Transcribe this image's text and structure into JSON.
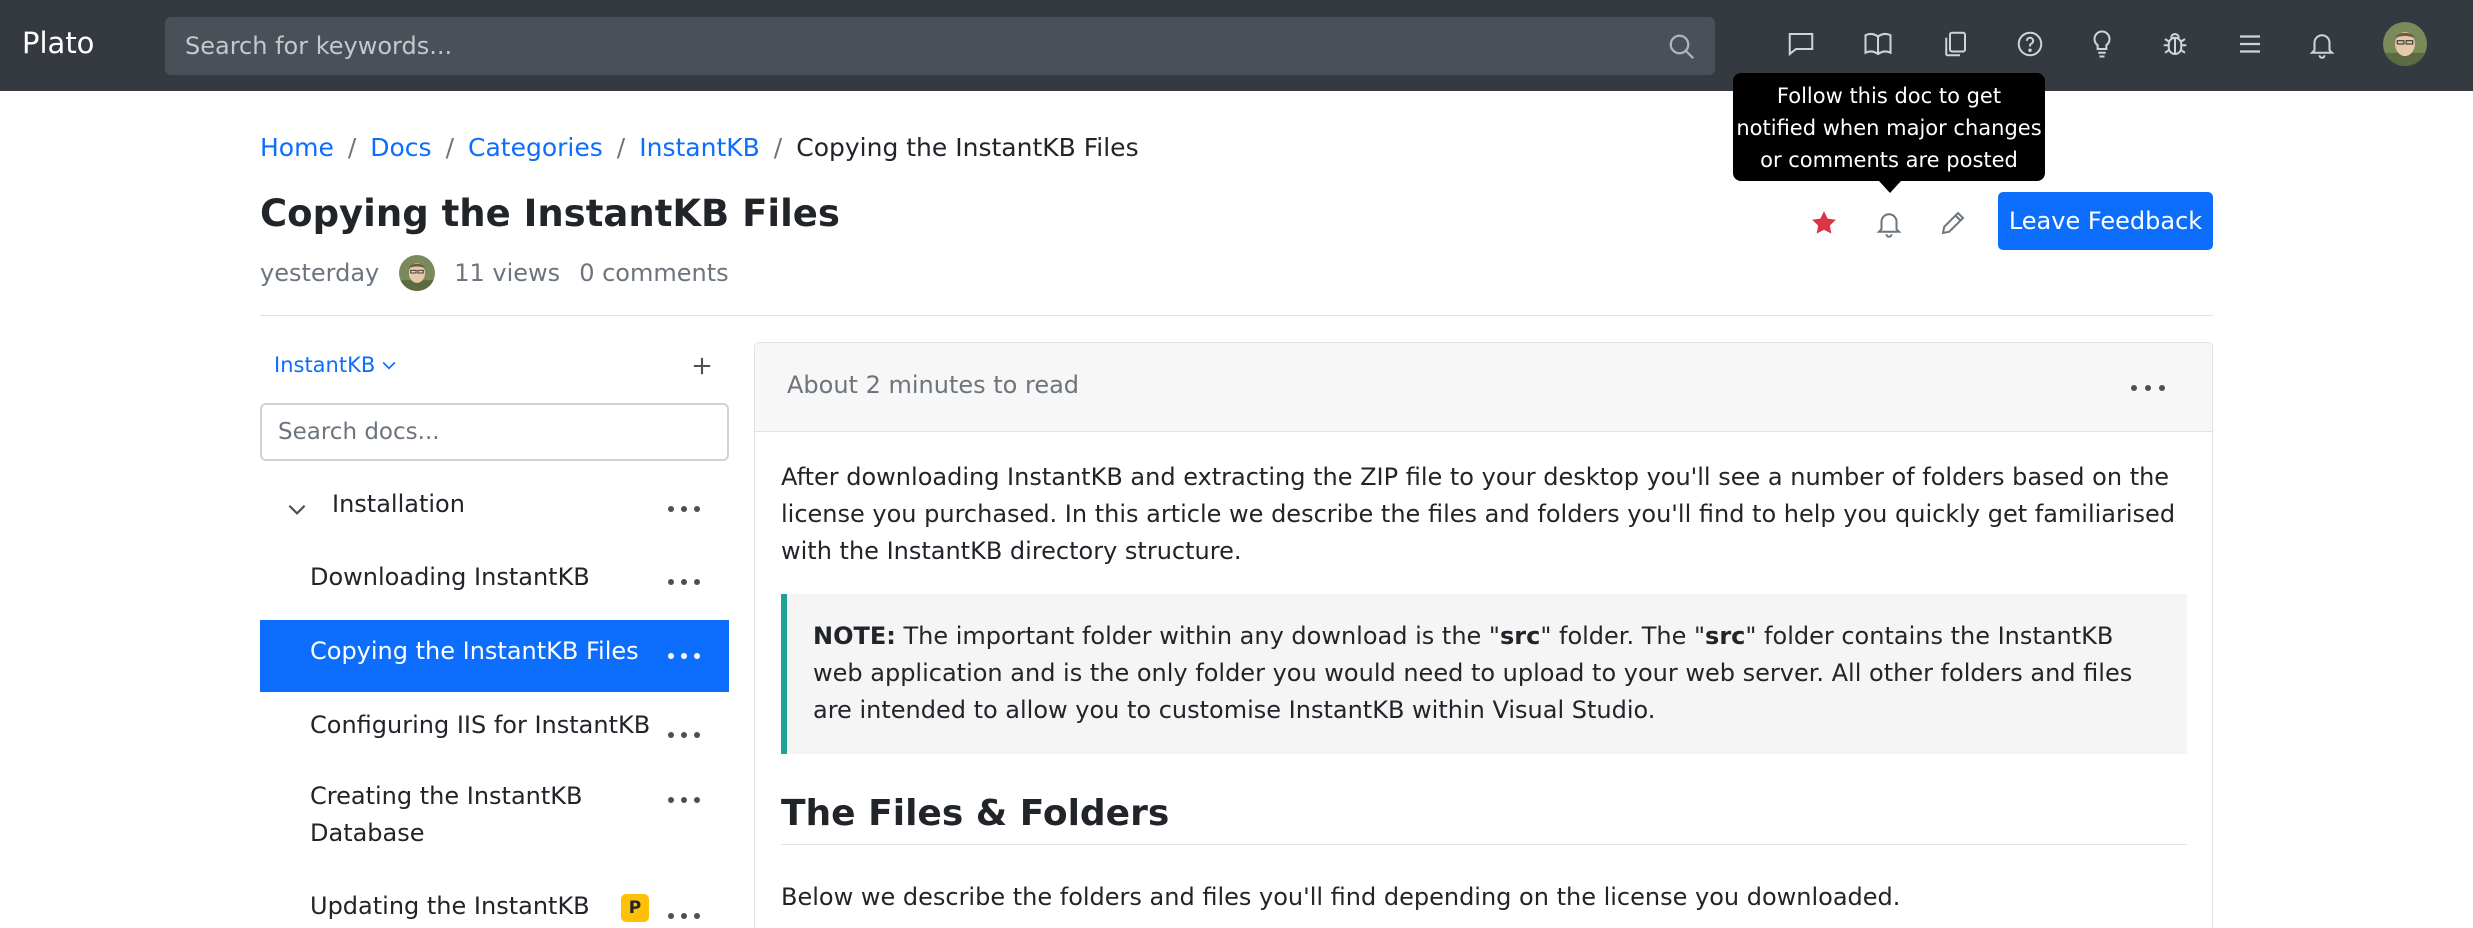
{
  "navbar": {
    "brand": "Plato",
    "search_placeholder": "Search for keywords...",
    "icons": [
      "chat-icon",
      "book-open-icon",
      "copy-docs-icon",
      "question-circle-icon",
      "lightbulb-icon",
      "bug-icon",
      "menu-list-icon",
      "bell-icon"
    ]
  },
  "tooltip": {
    "line1": "Follow this doc to get",
    "line2": "notified when major changes",
    "line3": "or comments are posted"
  },
  "breadcrumb": {
    "items": [
      "Home",
      "Docs",
      "Categories",
      "InstantKB"
    ],
    "current": "Copying the InstantKB Files"
  },
  "doc": {
    "title": "Copying the InstantKB Files",
    "date": "yesterday",
    "views": "11 views",
    "comments": "0 comments",
    "feedback_label": "Leave Feedback",
    "star_color": "#dc3545"
  },
  "sidebar": {
    "category": "InstantKB",
    "search_placeholder": "Search docs...",
    "section": "Installation",
    "items": [
      {
        "label": "Downloading InstantKB"
      },
      {
        "label": "Copying the InstantKB Files",
        "active": true
      },
      {
        "label": "Configuring IIS for InstantKB"
      },
      {
        "label": "Creating the InstantKB Database"
      },
      {
        "label": "Updating the InstantKB",
        "badge": "P"
      }
    ]
  },
  "content": {
    "read_time": "About 2 minutes to read",
    "intro": "After downloading InstantKB and extracting the ZIP file to your desktop you'll see a number of folders based on the license you purchased. In this article we describe the files and folders you'll find to help you quickly get familiarised with the InstantKB directory structure.",
    "note": {
      "label": "NOTE:",
      "t1": " The important folder within any download is the \"",
      "b1": "src",
      "t2": "\" folder. The \"",
      "b2": "src",
      "t3": "\" folder contains the InstantKB web application and is the only folder you would need to upload to your web server. All other folders and files are intended to allow you to customise InstantKB within Visual Studio."
    },
    "heading": "The Files & Folders",
    "below": "Below we describe the folders and files you'll find depending on the license you downloaded."
  },
  "colors": {
    "navbar": "#343a40",
    "primary": "#0d6efd",
    "note_border": "#20a197",
    "badge": "#ffc107"
  }
}
